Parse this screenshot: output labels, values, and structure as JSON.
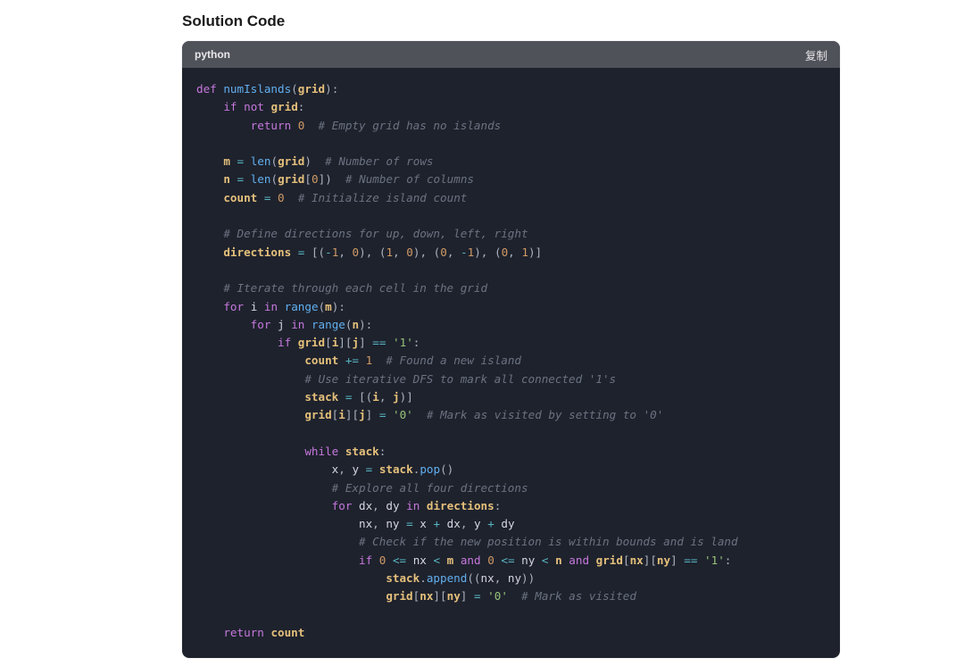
{
  "section_title": "Solution Code",
  "code_block": {
    "language": "python",
    "copy_label": "复制",
    "lines": [
      [
        [
          "kw",
          "def"
        ],
        [
          "sp",
          " "
        ],
        [
          "fn",
          "numIslands"
        ],
        [
          "pn",
          "("
        ],
        [
          "id",
          "grid"
        ],
        [
          "pn",
          ")"
        ],
        [
          "pn",
          ":"
        ]
      ],
      [
        [
          "in",
          1
        ],
        [
          "kw",
          "if"
        ],
        [
          "sp",
          " "
        ],
        [
          "kw",
          "not"
        ],
        [
          "sp",
          " "
        ],
        [
          "id",
          "grid"
        ],
        [
          "pn",
          ":"
        ]
      ],
      [
        [
          "in",
          2
        ],
        [
          "kw",
          "return"
        ],
        [
          "sp",
          " "
        ],
        [
          "num",
          "0"
        ],
        [
          "sp",
          "  "
        ],
        [
          "cm",
          "# Empty grid has no islands"
        ]
      ],
      [],
      [
        [
          "in",
          1
        ],
        [
          "id",
          "m"
        ],
        [
          "sp",
          " "
        ],
        [
          "op",
          "="
        ],
        [
          "sp",
          " "
        ],
        [
          "fn",
          "len"
        ],
        [
          "pn",
          "("
        ],
        [
          "id",
          "grid"
        ],
        [
          "pn",
          ")"
        ],
        [
          "sp",
          "  "
        ],
        [
          "cm",
          "# Number of rows"
        ]
      ],
      [
        [
          "in",
          1
        ],
        [
          "id",
          "n"
        ],
        [
          "sp",
          " "
        ],
        [
          "op",
          "="
        ],
        [
          "sp",
          " "
        ],
        [
          "fn",
          "len"
        ],
        [
          "pn",
          "("
        ],
        [
          "id",
          "grid"
        ],
        [
          "pn",
          "["
        ],
        [
          "num",
          "0"
        ],
        [
          "pn",
          "]"
        ],
        [
          "pn",
          ")"
        ],
        [
          "sp",
          "  "
        ],
        [
          "cm",
          "# Number of columns"
        ]
      ],
      [
        [
          "in",
          1
        ],
        [
          "id",
          "count"
        ],
        [
          "sp",
          " "
        ],
        [
          "op",
          "="
        ],
        [
          "sp",
          " "
        ],
        [
          "num",
          "0"
        ],
        [
          "sp",
          "  "
        ],
        [
          "cm",
          "# Initialize island count"
        ]
      ],
      [],
      [
        [
          "in",
          1
        ],
        [
          "cm",
          "# Define directions for up, down, left, right"
        ]
      ],
      [
        [
          "in",
          1
        ],
        [
          "id",
          "directions"
        ],
        [
          "sp",
          " "
        ],
        [
          "op",
          "="
        ],
        [
          "sp",
          " "
        ],
        [
          "pn",
          "["
        ],
        [
          "pn",
          "("
        ],
        [
          "op",
          "-"
        ],
        [
          "num",
          "1"
        ],
        [
          "pn",
          ","
        ],
        [
          "sp",
          " "
        ],
        [
          "num",
          "0"
        ],
        [
          "pn",
          ")"
        ],
        [
          "pn",
          ","
        ],
        [
          "sp",
          " "
        ],
        [
          "pn",
          "("
        ],
        [
          "num",
          "1"
        ],
        [
          "pn",
          ","
        ],
        [
          "sp",
          " "
        ],
        [
          "num",
          "0"
        ],
        [
          "pn",
          ")"
        ],
        [
          "pn",
          ","
        ],
        [
          "sp",
          " "
        ],
        [
          "pn",
          "("
        ],
        [
          "num",
          "0"
        ],
        [
          "pn",
          ","
        ],
        [
          "sp",
          " "
        ],
        [
          "op",
          "-"
        ],
        [
          "num",
          "1"
        ],
        [
          "pn",
          ")"
        ],
        [
          "pn",
          ","
        ],
        [
          "sp",
          " "
        ],
        [
          "pn",
          "("
        ],
        [
          "num",
          "0"
        ],
        [
          "pn",
          ","
        ],
        [
          "sp",
          " "
        ],
        [
          "num",
          "1"
        ],
        [
          "pn",
          ")"
        ],
        [
          "pn",
          "]"
        ]
      ],
      [],
      [
        [
          "in",
          1
        ],
        [
          "cm",
          "# Iterate through each cell in the grid"
        ]
      ],
      [
        [
          "in",
          1
        ],
        [
          "kw",
          "for"
        ],
        [
          "sp",
          " "
        ],
        [
          "idp",
          "i"
        ],
        [
          "sp",
          " "
        ],
        [
          "kw",
          "in"
        ],
        [
          "sp",
          " "
        ],
        [
          "fn",
          "range"
        ],
        [
          "pn",
          "("
        ],
        [
          "id",
          "m"
        ],
        [
          "pn",
          ")"
        ],
        [
          "pn",
          ":"
        ]
      ],
      [
        [
          "in",
          2
        ],
        [
          "kw",
          "for"
        ],
        [
          "sp",
          " "
        ],
        [
          "idp",
          "j"
        ],
        [
          "sp",
          " "
        ],
        [
          "kw",
          "in"
        ],
        [
          "sp",
          " "
        ],
        [
          "fn",
          "range"
        ],
        [
          "pn",
          "("
        ],
        [
          "id",
          "n"
        ],
        [
          "pn",
          ")"
        ],
        [
          "pn",
          ":"
        ]
      ],
      [
        [
          "in",
          3
        ],
        [
          "kw",
          "if"
        ],
        [
          "sp",
          " "
        ],
        [
          "id",
          "grid"
        ],
        [
          "pn",
          "["
        ],
        [
          "id",
          "i"
        ],
        [
          "pn",
          "]"
        ],
        [
          "pn",
          "["
        ],
        [
          "id",
          "j"
        ],
        [
          "pn",
          "]"
        ],
        [
          "sp",
          " "
        ],
        [
          "op",
          "=="
        ],
        [
          "sp",
          " "
        ],
        [
          "str",
          "'1'"
        ],
        [
          "pn",
          ":"
        ]
      ],
      [
        [
          "in",
          4
        ],
        [
          "id",
          "count"
        ],
        [
          "sp",
          " "
        ],
        [
          "op",
          "+="
        ],
        [
          "sp",
          " "
        ],
        [
          "num",
          "1"
        ],
        [
          "sp",
          "  "
        ],
        [
          "cm",
          "# Found a new island"
        ]
      ],
      [
        [
          "in",
          4
        ],
        [
          "cm",
          "# Use iterative DFS to mark all connected '1's"
        ]
      ],
      [
        [
          "in",
          4
        ],
        [
          "id",
          "stack"
        ],
        [
          "sp",
          " "
        ],
        [
          "op",
          "="
        ],
        [
          "sp",
          " "
        ],
        [
          "pn",
          "["
        ],
        [
          "pn",
          "("
        ],
        [
          "id",
          "i"
        ],
        [
          "pn",
          ","
        ],
        [
          "sp",
          " "
        ],
        [
          "id",
          "j"
        ],
        [
          "pn",
          ")"
        ],
        [
          "pn",
          "]"
        ]
      ],
      [
        [
          "in",
          4
        ],
        [
          "id",
          "grid"
        ],
        [
          "pn",
          "["
        ],
        [
          "id",
          "i"
        ],
        [
          "pn",
          "]"
        ],
        [
          "pn",
          "["
        ],
        [
          "id",
          "j"
        ],
        [
          "pn",
          "]"
        ],
        [
          "sp",
          " "
        ],
        [
          "op",
          "="
        ],
        [
          "sp",
          " "
        ],
        [
          "str",
          "'0'"
        ],
        [
          "sp",
          "  "
        ],
        [
          "cm",
          "# Mark as visited by setting to '0'"
        ]
      ],
      [],
      [
        [
          "in",
          4
        ],
        [
          "kw",
          "while"
        ],
        [
          "sp",
          " "
        ],
        [
          "id",
          "stack"
        ],
        [
          "pn",
          ":"
        ]
      ],
      [
        [
          "in",
          5
        ],
        [
          "idp",
          "x"
        ],
        [
          "pn",
          ","
        ],
        [
          "sp",
          " "
        ],
        [
          "idp",
          "y"
        ],
        [
          "sp",
          " "
        ],
        [
          "op",
          "="
        ],
        [
          "sp",
          " "
        ],
        [
          "id",
          "stack"
        ],
        [
          "pn",
          "."
        ],
        [
          "fn",
          "pop"
        ],
        [
          "pn",
          "("
        ],
        [
          "pn",
          ")"
        ]
      ],
      [
        [
          "in",
          5
        ],
        [
          "cm",
          "# Explore all four directions"
        ]
      ],
      [
        [
          "in",
          5
        ],
        [
          "kw",
          "for"
        ],
        [
          "sp",
          " "
        ],
        [
          "idp",
          "dx"
        ],
        [
          "pn",
          ","
        ],
        [
          "sp",
          " "
        ],
        [
          "idp",
          "dy"
        ],
        [
          "sp",
          " "
        ],
        [
          "kw",
          "in"
        ],
        [
          "sp",
          " "
        ],
        [
          "id",
          "directions"
        ],
        [
          "pn",
          ":"
        ]
      ],
      [
        [
          "in",
          6
        ],
        [
          "idp",
          "nx"
        ],
        [
          "pn",
          ","
        ],
        [
          "sp",
          " "
        ],
        [
          "idp",
          "ny"
        ],
        [
          "sp",
          " "
        ],
        [
          "op",
          "="
        ],
        [
          "sp",
          " "
        ],
        [
          "idp",
          "x"
        ],
        [
          "sp",
          " "
        ],
        [
          "op",
          "+"
        ],
        [
          "sp",
          " "
        ],
        [
          "idp",
          "dx"
        ],
        [
          "pn",
          ","
        ],
        [
          "sp",
          " "
        ],
        [
          "idp",
          "y"
        ],
        [
          "sp",
          " "
        ],
        [
          "op",
          "+"
        ],
        [
          "sp",
          " "
        ],
        [
          "idp",
          "dy"
        ]
      ],
      [
        [
          "in",
          6
        ],
        [
          "cm",
          "# Check if the new position is within bounds and is land"
        ]
      ],
      [
        [
          "in",
          6
        ],
        [
          "kw",
          "if"
        ],
        [
          "sp",
          " "
        ],
        [
          "num",
          "0"
        ],
        [
          "sp",
          " "
        ],
        [
          "op",
          "<="
        ],
        [
          "sp",
          " "
        ],
        [
          "idp",
          "nx"
        ],
        [
          "sp",
          " "
        ],
        [
          "op",
          "<"
        ],
        [
          "sp",
          " "
        ],
        [
          "id",
          "m"
        ],
        [
          "sp",
          " "
        ],
        [
          "kw",
          "and"
        ],
        [
          "sp",
          " "
        ],
        [
          "num",
          "0"
        ],
        [
          "sp",
          " "
        ],
        [
          "op",
          "<="
        ],
        [
          "sp",
          " "
        ],
        [
          "idp",
          "ny"
        ],
        [
          "sp",
          " "
        ],
        [
          "op",
          "<"
        ],
        [
          "sp",
          " "
        ],
        [
          "id",
          "n"
        ],
        [
          "sp",
          " "
        ],
        [
          "kw",
          "and"
        ],
        [
          "sp",
          " "
        ],
        [
          "id",
          "grid"
        ],
        [
          "pn",
          "["
        ],
        [
          "id",
          "nx"
        ],
        [
          "pn",
          "]"
        ],
        [
          "pn",
          "["
        ],
        [
          "id",
          "ny"
        ],
        [
          "pn",
          "]"
        ],
        [
          "sp",
          " "
        ],
        [
          "op",
          "=="
        ],
        [
          "sp",
          " "
        ],
        [
          "str",
          "'1'"
        ],
        [
          "pn",
          ":"
        ]
      ],
      [
        [
          "in",
          7
        ],
        [
          "id",
          "stack"
        ],
        [
          "pn",
          "."
        ],
        [
          "fn",
          "append"
        ],
        [
          "pn",
          "("
        ],
        [
          "pn",
          "("
        ],
        [
          "idp",
          "nx"
        ],
        [
          "pn",
          ","
        ],
        [
          "sp",
          " "
        ],
        [
          "idp",
          "ny"
        ],
        [
          "pn",
          ")"
        ],
        [
          "pn",
          ")"
        ]
      ],
      [
        [
          "in",
          7
        ],
        [
          "id",
          "grid"
        ],
        [
          "pn",
          "["
        ],
        [
          "id",
          "nx"
        ],
        [
          "pn",
          "]"
        ],
        [
          "pn",
          "["
        ],
        [
          "id",
          "ny"
        ],
        [
          "pn",
          "]"
        ],
        [
          "sp",
          " "
        ],
        [
          "op",
          "="
        ],
        [
          "sp",
          " "
        ],
        [
          "str",
          "'0'"
        ],
        [
          "sp",
          "  "
        ],
        [
          "cm",
          "# Mark as visited"
        ]
      ],
      [],
      [
        [
          "in",
          1
        ],
        [
          "kw",
          "return"
        ],
        [
          "sp",
          " "
        ],
        [
          "id",
          "count"
        ]
      ]
    ]
  }
}
